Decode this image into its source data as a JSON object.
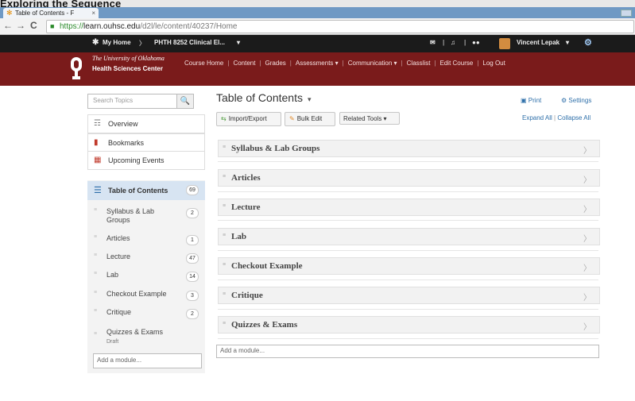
{
  "overlay_title": "Exploring the Sequence",
  "browser": {
    "tab_title": "Table of Contents - F",
    "tab_close": "×",
    "back": "←",
    "forward": "→",
    "reload": "C",
    "url_scheme": "https://",
    "url_host": "learn.ouhsc.edu",
    "url_path": "/d2l/le/content/40237/Home"
  },
  "navbar": {
    "my_home": "My Home",
    "separator": "〉",
    "course": "PHTH 8252 Clinical El...",
    "course_caret": "▾",
    "icons_sep": "|",
    "user": "Vincent Lepak",
    "user_caret": "▾"
  },
  "banner": {
    "university": "The University of Oklahoma",
    "hsc": "Health Sciences Center",
    "nav": [
      "Course Home",
      "Content",
      "Grades",
      "Assessments ▾",
      "Communication ▾",
      "Classlist",
      "Edit Course",
      "Log Out"
    ]
  },
  "sidebar": {
    "search_placeholder": "Search Topics",
    "links": [
      {
        "label": "Overview",
        "icon": "overview-icon"
      },
      {
        "label": "Bookmarks",
        "icon": "bookmark-icon"
      },
      {
        "label": "Upcoming Events",
        "icon": "calendar-icon"
      }
    ],
    "toc": {
      "label": "Table of Contents",
      "count": "69"
    },
    "modules": [
      {
        "label": "Syllabus & Lab Groups",
        "count": "2"
      },
      {
        "label": "Articles",
        "count": "1"
      },
      {
        "label": "Lecture",
        "count": "47"
      },
      {
        "label": "Lab",
        "count": "14"
      },
      {
        "label": "Checkout Example",
        "count": "3"
      },
      {
        "label": "Critique",
        "count": "2"
      },
      {
        "label": "Quizzes & Exams",
        "sub": "Draft"
      }
    ],
    "add_module": "Add a module..."
  },
  "main": {
    "title": "Table of Contents",
    "title_caret": "▾",
    "print": "Print",
    "settings": "Settings",
    "import_export": "Import/Export",
    "bulk_edit": "Bulk Edit",
    "related_tools": "Related Tools ▾",
    "expand_all": "Expand All",
    "collapse_all": "Collapse All",
    "expand_sep": "|",
    "modules": [
      "Syllabus & Lab Groups",
      "Articles",
      "Lecture",
      "Lab",
      "Checkout Example",
      "Critique",
      "Quizzes & Exams"
    ],
    "add_module": "Add a module..."
  },
  "colors": {
    "banner": "#7a1b1b",
    "navbar": "#1b1b1b",
    "link": "#2e6fa9",
    "toc_selected": "#d7e4f2"
  }
}
